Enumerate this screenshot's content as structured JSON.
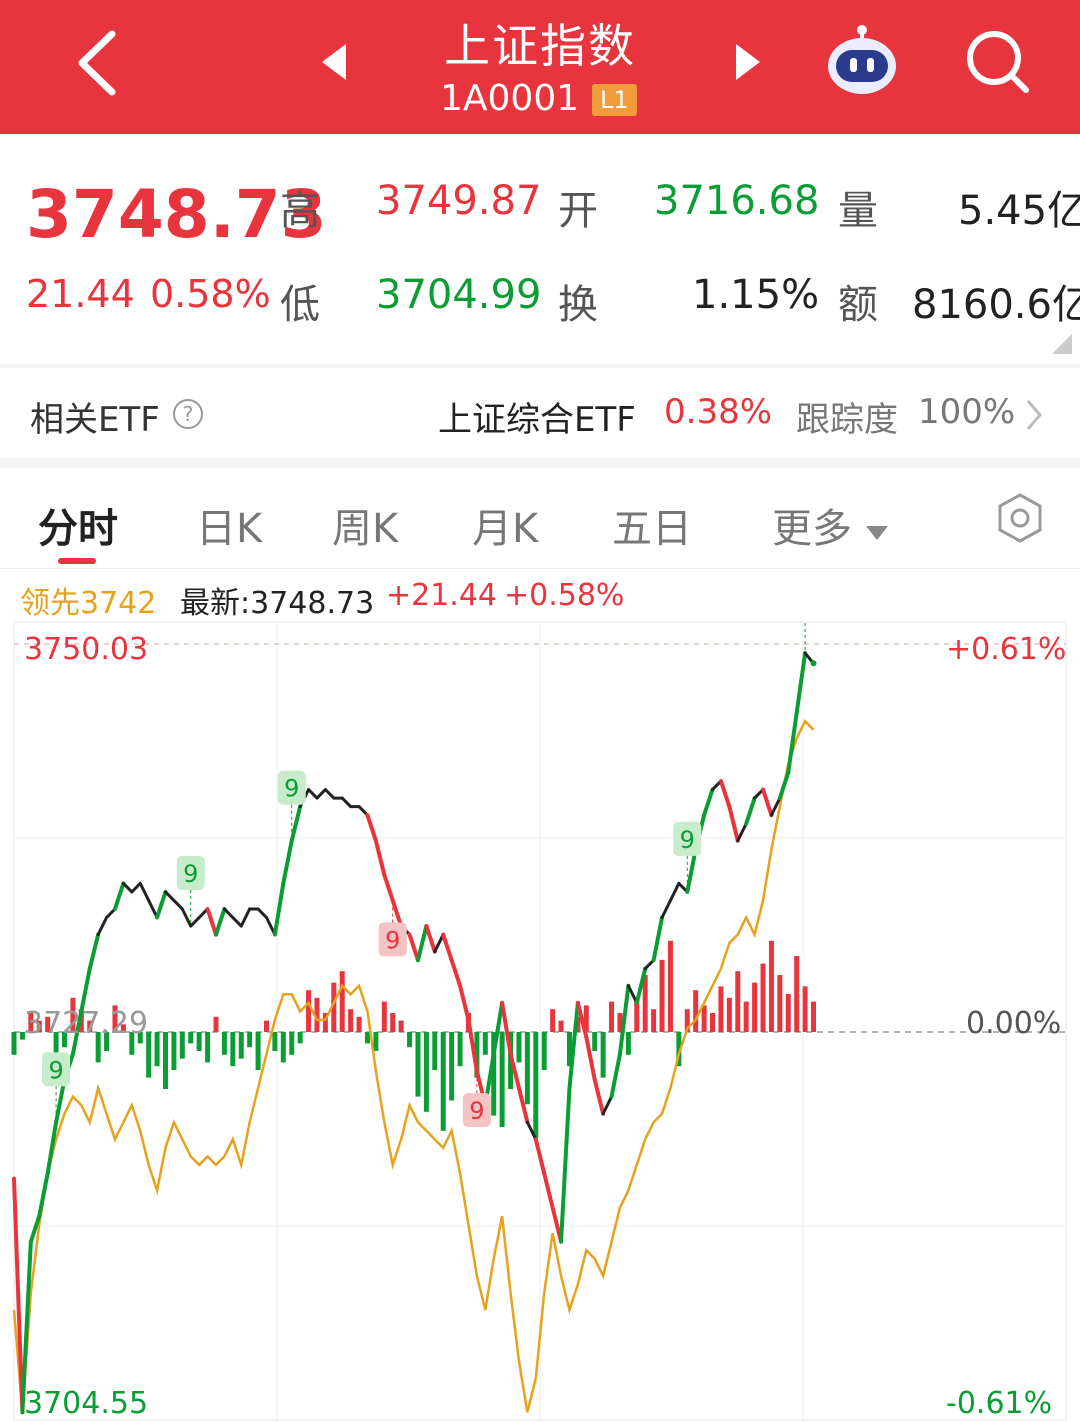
{
  "header": {
    "title": "上证指数",
    "code": "1A0001",
    "level_badge": "L1"
  },
  "quote": {
    "last": "3748.73",
    "change": "21.44",
    "change_pct": "0.58%",
    "high_label": "高",
    "high": "3749.87",
    "low_label": "低",
    "low": "3704.99",
    "open_label": "开",
    "open": "3716.68",
    "turnover_label": "换",
    "turnover": "1.15%",
    "volume_label": "量",
    "volume": "5.45亿",
    "amount_label": "额",
    "amount": "8160.6亿"
  },
  "etf": {
    "label": "相关ETF",
    "name": "上证综合ETF",
    "pct": "0.38%",
    "tracking_label": "跟踪度",
    "tracking": "100%"
  },
  "tabs": [
    {
      "label": "分时"
    },
    {
      "label": "日K"
    },
    {
      "label": "周K"
    },
    {
      "label": "月K"
    },
    {
      "label": "五日"
    },
    {
      "label": "更多"
    }
  ],
  "legend": {
    "lead": "领先3742",
    "latest": "最新:3748.73",
    "change": "+21.44",
    "pct": "+0.58%"
  },
  "colors": {
    "red": "#e8343d",
    "green": "#0a9d33",
    "orange": "#e6a21c",
    "line": "#222222"
  },
  "chart_data": {
    "type": "line",
    "y_axis_left": {
      "top": "3750.03",
      "bottom": "3704.55",
      "mid": "3727.29"
    },
    "y_axis_right": {
      "top": "+0.61%",
      "mid": "0.00%",
      "bottom": "-0.61%"
    },
    "ylim": [
      3704.55,
      3750.03
    ],
    "prev_close": 3727.29,
    "series": [
      {
        "values": [
          3718.7,
          3705.0,
          3715.0,
          3716.5,
          3719.0,
          3722.0,
          3724.5,
          3726.0,
          3728.5,
          3731.0,
          3733.0,
          3734.0,
          3734.5,
          3736.0,
          3735.5,
          3736.0,
          3735.0,
          3734.0,
          3735.5,
          3735.0,
          3734.5,
          3733.5,
          3734.0,
          3734.5,
          3733.0,
          3734.5,
          3734.0,
          3733.5,
          3734.5,
          3734.5,
          3734.0,
          3733.0,
          3736.0,
          3738.5,
          3740.5,
          3741.5,
          3741.0,
          3741.5,
          3741.0,
          3741.0,
          3740.5,
          3740.5,
          3740.0,
          3738.5,
          3736.5,
          3735.0,
          3733.5,
          3733.0,
          3731.5,
          3733.5,
          3732.0,
          3733.0,
          3731.5,
          3730.0,
          3728.0,
          3725.0,
          3723.0,
          3726.0,
          3729.0,
          3726.0,
          3724.0,
          3722.0,
          3721.0,
          3719.0,
          3717.0,
          3715.0,
          3724.0,
          3729.0,
          3727.0,
          3724.5,
          3722.5,
          3723.5,
          3726.0,
          3730.0,
          3729.0,
          3731.0,
          3731.5,
          3734.0,
          3735.0,
          3736.0,
          3735.5,
          3738.0,
          3740.0,
          3741.5,
          3742.0,
          3740.5,
          3738.5,
          3739.5,
          3741.0,
          3741.5,
          3740.0,
          3741.0,
          3742.5,
          3746.0,
          3749.5,
          3748.9
        ]
      },
      {
        "values": [
          3711.0,
          3705.0,
          3712.0,
          3716.0,
          3719.0,
          3721.0,
          3722.5,
          3723.5,
          3723.0,
          3722.0,
          3724.0,
          3722.5,
          3721.0,
          3722.0,
          3723.0,
          3721.5,
          3719.5,
          3718.0,
          3720.5,
          3722.0,
          3721.0,
          3720.0,
          3719.5,
          3720.0,
          3719.5,
          3720.0,
          3721.0,
          3719.5,
          3722.0,
          3724.0,
          3726.0,
          3728.0,
          3729.5,
          3729.5,
          3728.5,
          3729.0,
          3728.0,
          3728.0,
          3729.0,
          3730.0,
          3729.5,
          3730.0,
          3728.5,
          3725.0,
          3722.0,
          3719.5,
          3721.0,
          3723.0,
          3722.0,
          3721.5,
          3721.0,
          3720.5,
          3721.5,
          3719.0,
          3716.0,
          3713.0,
          3711.0,
          3714.0,
          3716.5,
          3712.0,
          3708.0,
          3705.0,
          3707.0,
          3712.0,
          3715.5,
          3713.0,
          3711.0,
          3712.5,
          3714.5,
          3714.0,
          3713.0,
          3715.0,
          3717.0,
          3718.0,
          3719.5,
          3721.0,
          3722.0,
          3722.5,
          3724.0,
          3726.0,
          3727.5,
          3728.0,
          3729.0,
          3730.0,
          3731.0,
          3732.5,
          3733.0,
          3734.0,
          3733.0,
          3735.0,
          3738.0,
          3740.5,
          3743.0,
          3744.5,
          3745.5,
          3745.0
        ]
      }
    ],
    "volume_bars": [
      -0.6,
      -0.2,
      0.5,
      0.3,
      0.4,
      -0.7,
      -0.4,
      0.9,
      0.6,
      0.3,
      -0.8,
      -0.5,
      0.7,
      0.2,
      -0.6,
      -0.3,
      -1.2,
      -0.9,
      -1.5,
      -1.0,
      -0.7,
      -0.3,
      -0.5,
      -0.8,
      0.4,
      -0.6,
      -0.9,
      -0.7,
      -0.4,
      -1.0,
      0.3,
      -0.5,
      -0.8,
      -0.6,
      -0.3,
      1.1,
      0.9,
      0.5,
      1.3,
      1.6,
      0.6,
      0.4,
      -0.3,
      -0.5,
      0.8,
      0.5,
      0.3,
      -0.4,
      -1.7,
      -2.1,
      -1.0,
      -2.6,
      -1.8,
      -0.9,
      0.5,
      -1.2,
      -0.6,
      -2.2,
      -2.5,
      -1.5,
      -0.8,
      -1.9,
      -2.8,
      -1.0,
      0.6,
      0.3,
      -0.9,
      0.4,
      0.7,
      -0.5,
      -1.2,
      0.8,
      0.5,
      -0.6,
      0.9,
      1.5,
      0.6,
      1.9,
      2.4,
      -0.9,
      0.6,
      1.1,
      0.7,
      0.5,
      1.2,
      0.9,
      1.6,
      0.8,
      1.3,
      1.8,
      2.4,
      1.5,
      1.0,
      2.0,
      1.2,
      0.8
    ],
    "markers": [
      {
        "label": "9",
        "kind": "green",
        "i": 21
      },
      {
        "label": "9",
        "kind": "green",
        "i": 5
      },
      {
        "label": "9",
        "kind": "green",
        "i": 33
      },
      {
        "label": "9",
        "kind": "red",
        "i": 45
      },
      {
        "label": "9",
        "kind": "red",
        "i": 55
      },
      {
        "label": "9",
        "kind": "green",
        "i": 80
      },
      {
        "label": "9",
        "kind": "green",
        "i": 94
      }
    ]
  }
}
